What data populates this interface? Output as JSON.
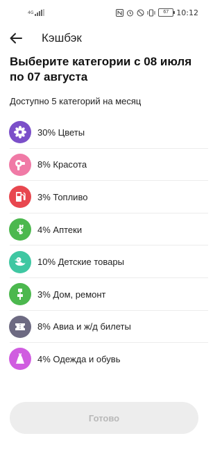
{
  "status_bar": {
    "network_text": "4G",
    "battery_level": "67",
    "time": "10:12",
    "icons": [
      "nfc-icon",
      "alarm-icon",
      "mute-icon",
      "vibrate-icon",
      "battery-icon"
    ]
  },
  "header": {
    "title": "Кэшбэк",
    "back_icon": "arrow-left-icon"
  },
  "page": {
    "heading": "Выберите категории с 08 июля по 07 августа",
    "subtitle": "Доступно 5 категорий на месяц"
  },
  "categories": [
    {
      "label": "30% Цветы",
      "icon": "flower-icon",
      "color": "#7b4fc9"
    },
    {
      "label": "8% Красота",
      "icon": "hair-dryer-icon",
      "color": "#f07aa6"
    },
    {
      "label": "3% Топливо",
      "icon": "fuel-pump-icon",
      "color": "#e8474f"
    },
    {
      "label": "4% Аптеки",
      "icon": "pharmacy-icon",
      "color": "#4cb84e"
    },
    {
      "label": "10% Детские товары",
      "icon": "rubber-duck-icon",
      "color": "#3fc7a2"
    },
    {
      "label": "3% Дом, ремонт",
      "icon": "paint-roller-icon",
      "color": "#4cb84e"
    },
    {
      "label": "8% Авиа и ж/д билеты",
      "icon": "ticket-icon",
      "color": "#6d6a82"
    },
    {
      "label": "4% Одежда и обувь",
      "icon": "dress-icon",
      "color": "#d05de0"
    }
  ],
  "footer": {
    "done_label": "Готово",
    "done_bg": "#ededed",
    "done_text_color": "#b8b8b8"
  }
}
